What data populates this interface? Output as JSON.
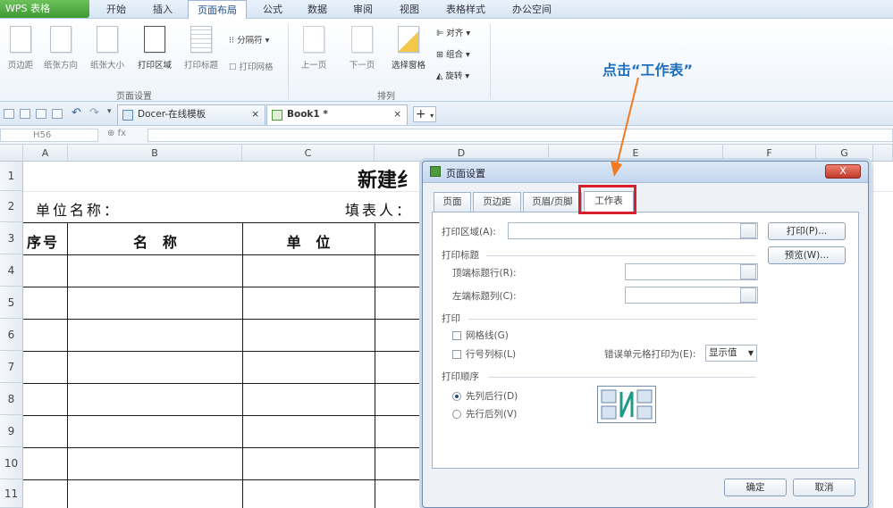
{
  "app": {
    "menu_button": "WPS 表格"
  },
  "menu_tabs": [
    {
      "label": "开始"
    },
    {
      "label": "插入"
    },
    {
      "label": "页面布局",
      "active": true
    },
    {
      "label": "公式"
    },
    {
      "label": "数据"
    },
    {
      "label": "审阅"
    },
    {
      "label": "视图"
    },
    {
      "label": "表格样式"
    },
    {
      "label": "办公空间"
    }
  ],
  "ribbon": {
    "buttons": [
      "页边距",
      "纸张方向",
      "纸张大小",
      "打印区域",
      "打印标题",
      "上一页",
      "下一页",
      "选择窗格"
    ],
    "small": {
      "page_break": "分隔符",
      "print_gridlines": "打印网格",
      "align": "对齐",
      "group": "组合",
      "rotate": "旋转"
    },
    "groups": {
      "page_setup": "页面设置",
      "arrange": "排列"
    }
  },
  "doc_tabs": [
    {
      "label": "Docer-在线模板"
    },
    {
      "label": "Book1 *"
    }
  ],
  "formula_bar": {
    "cell_ref": "H56",
    "fx": "fx"
  },
  "sheet": {
    "columns": [
      "A",
      "B",
      "C",
      "D",
      "E",
      "F",
      "G"
    ],
    "rows": [
      "1",
      "2",
      "3",
      "4",
      "5",
      "6",
      "7",
      "8",
      "9",
      "10",
      "11"
    ],
    "title_text": "新建纟",
    "unit_label": "单位名称：",
    "filler_label": "填表人：",
    "header_seq": "序号",
    "header_name": "名   称",
    "header_unit": "单   位"
  },
  "dialog": {
    "title": "页面设置",
    "tabs": [
      "页面",
      "页边距",
      "页眉/页脚",
      "工作表"
    ],
    "active_tab": "工作表",
    "print_area_label": "打印区域(A):",
    "print_button": "打印(P)...",
    "preview_button": "预览(W)...",
    "print_titles_section": "打印标题",
    "top_rows_label": "顶端标题行(R):",
    "left_cols_label": "左端标题列(C):",
    "print_section": "打印",
    "gridlines_label": "网格线(G)",
    "row_col_headers_label": "行号列标(L)",
    "error_cells_label": "错误单元格打印为(E):",
    "error_cells_value": "显示值",
    "order_section": "打印顺序",
    "order_down_then_over": "先列后行(D)",
    "order_over_then_down": "先行后列(V)",
    "ok_button": "确定",
    "cancel_button": "取消",
    "close_button": "X"
  },
  "annotation": {
    "text": "点击“工作表”",
    "color": "#1f6fbd",
    "arrow_color": "#f07b22",
    "box_color": "#d9202a"
  }
}
